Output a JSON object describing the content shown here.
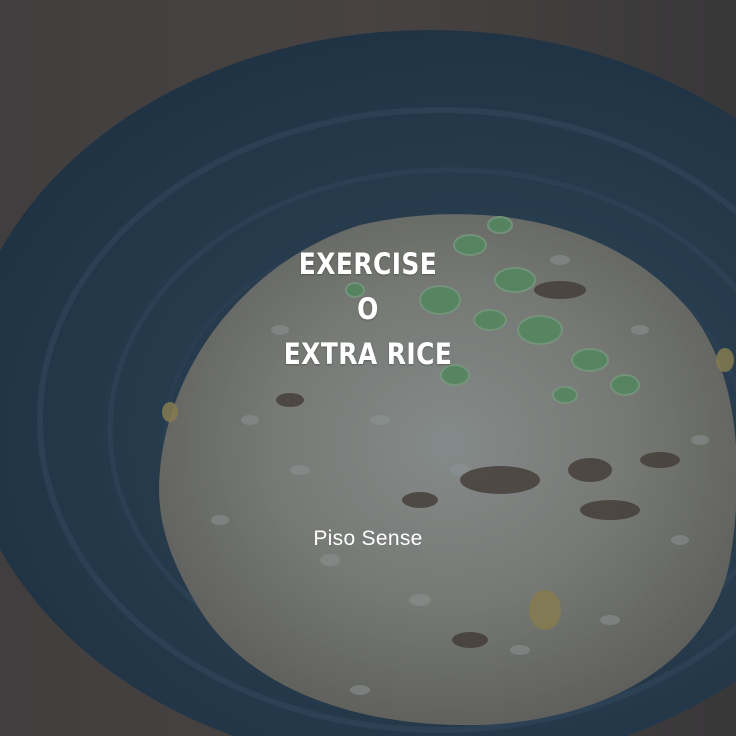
{
  "headline": {
    "line1": "EXERCISE",
    "line2": "O",
    "line3": "EXTRA RICE"
  },
  "brand": "Piso Sense",
  "colors": {
    "overlay": "#1e3a52",
    "text": "#ffffff",
    "bowl": "#2e3e4c",
    "table": "#5a3f2b"
  }
}
